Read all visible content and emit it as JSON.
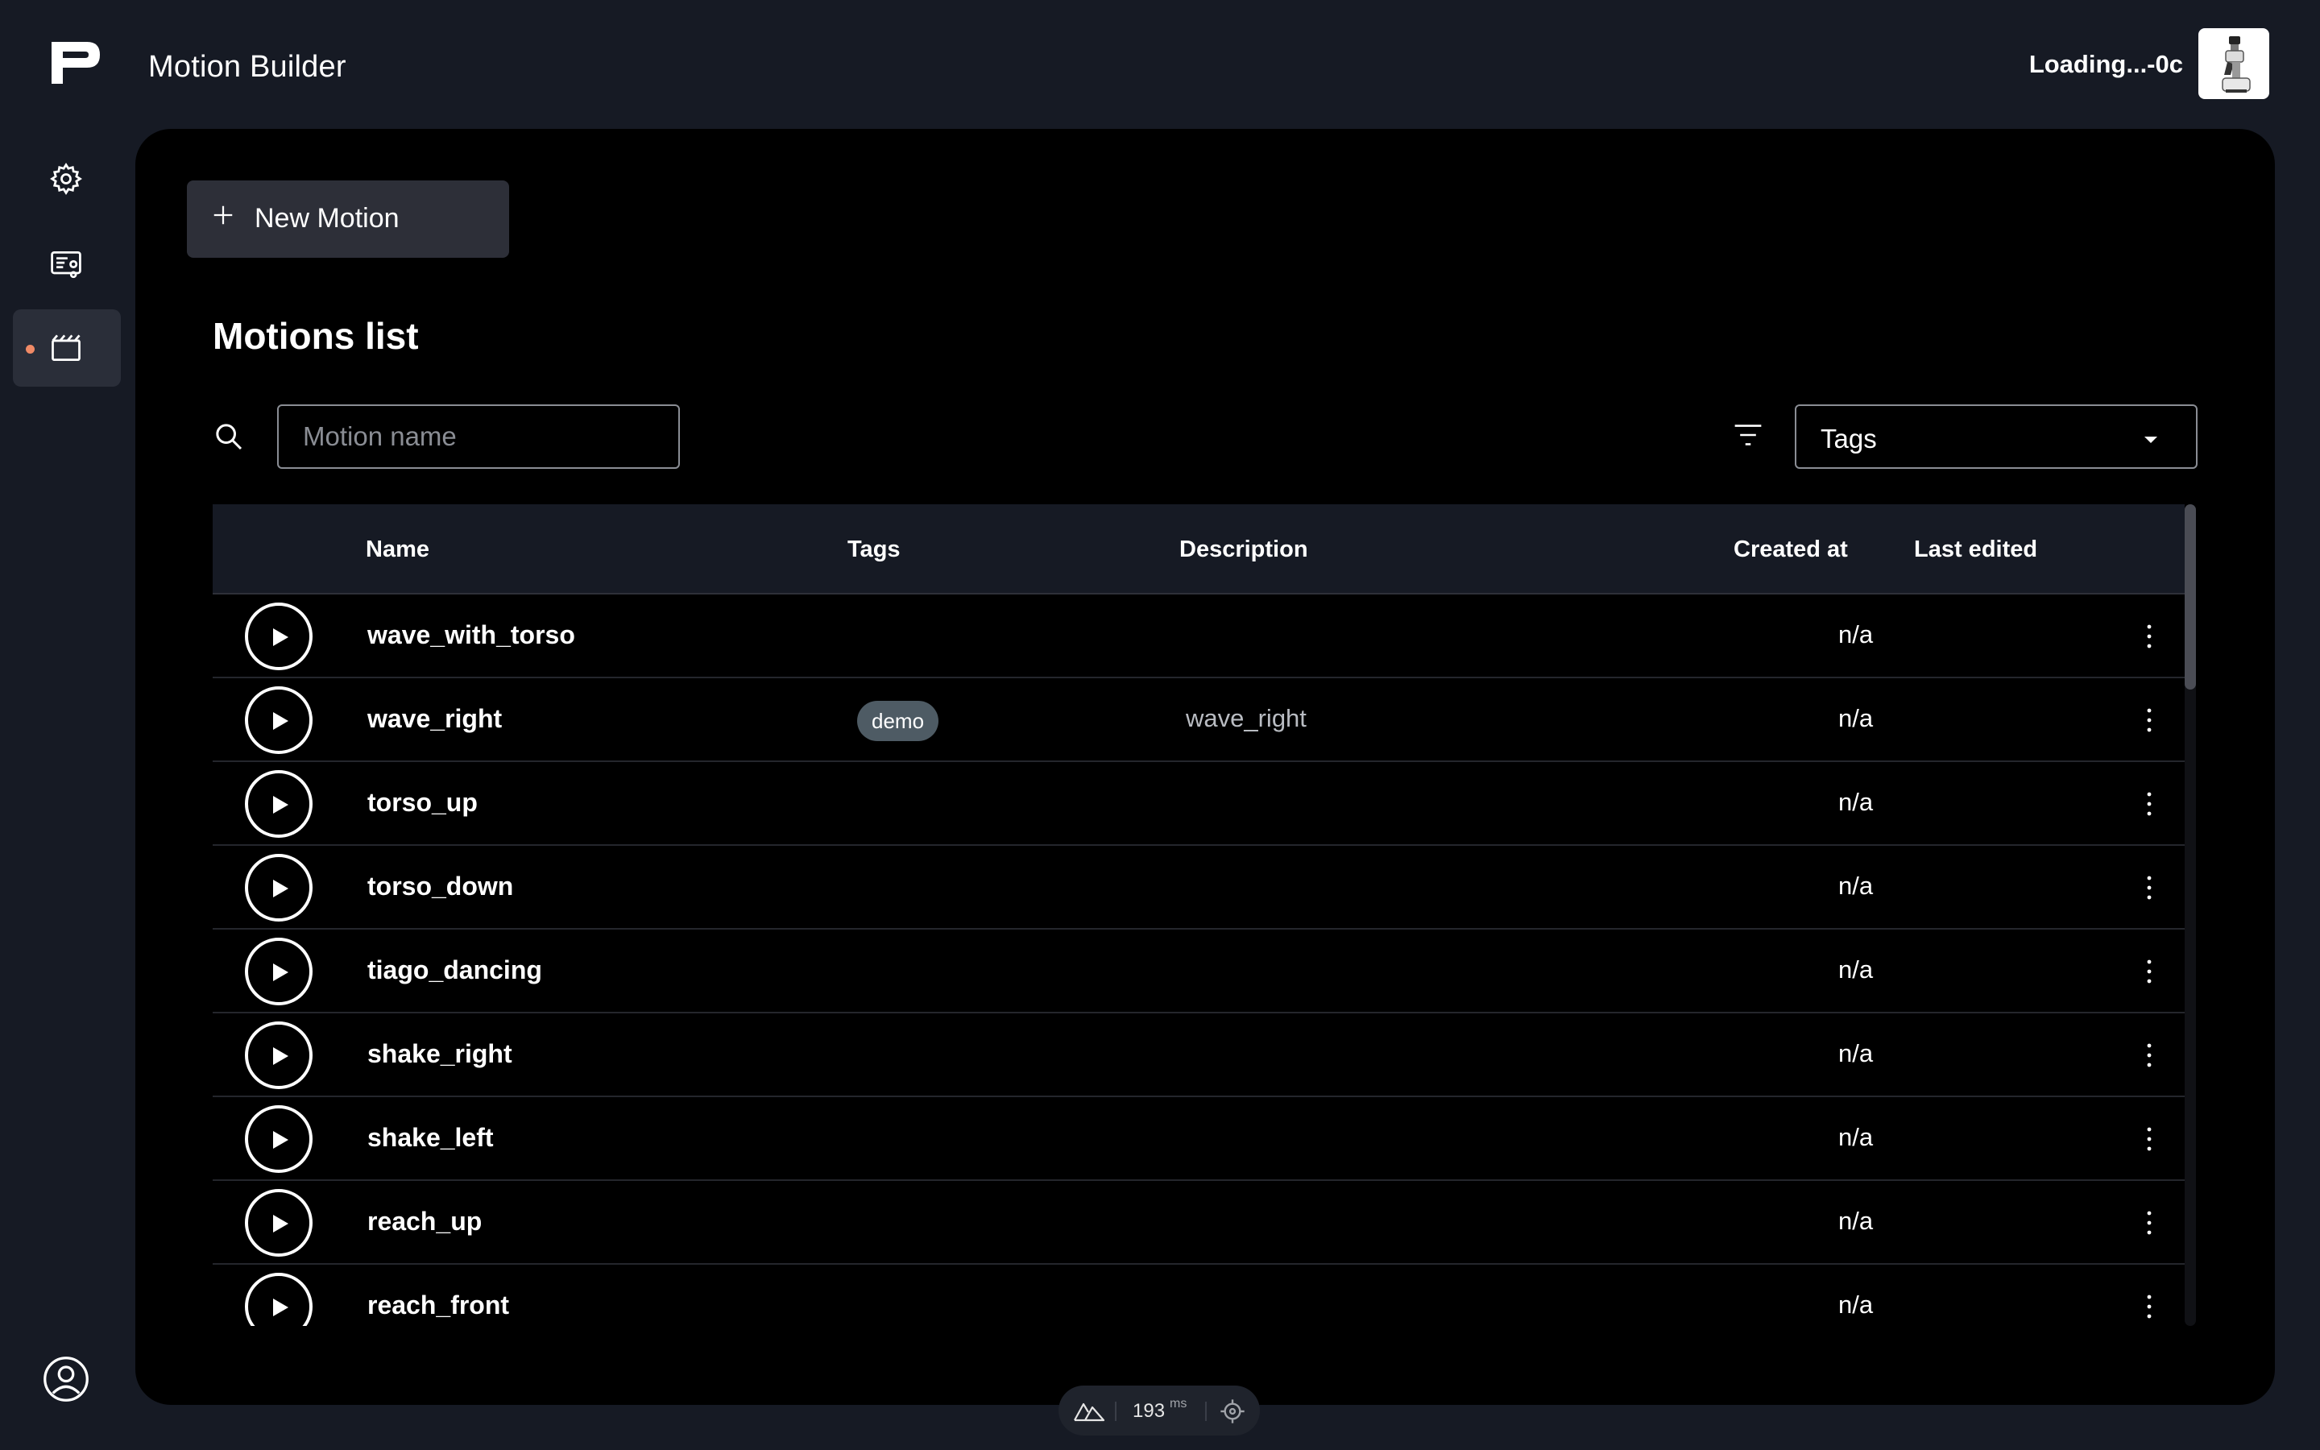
{
  "header": {
    "title": "Motion Builder",
    "status": "Loading...-0c"
  },
  "sidebar": {
    "items": [
      {
        "icon": "gear-icon",
        "active": false
      },
      {
        "icon": "settings-list-icon",
        "active": false
      },
      {
        "icon": "clapperboard-icon",
        "active": true
      }
    ]
  },
  "toolbar": {
    "new_label": "New Motion"
  },
  "list": {
    "title": "Motions list",
    "search_placeholder": "Motion name",
    "tags_select": "Tags"
  },
  "table": {
    "columns": [
      "Name",
      "Tags",
      "Description",
      "Created at",
      "Last edited"
    ],
    "rows": [
      {
        "name": "wave_with_torso",
        "tag": "",
        "description": "",
        "created": "n/a"
      },
      {
        "name": "wave_right",
        "tag": "demo",
        "description": "wave_right",
        "created": "n/a"
      },
      {
        "name": "torso_up",
        "tag": "",
        "description": "",
        "created": "n/a"
      },
      {
        "name": "torso_down",
        "tag": "",
        "description": "",
        "created": "n/a"
      },
      {
        "name": "tiago_dancing",
        "tag": "",
        "description": "",
        "created": "n/a"
      },
      {
        "name": "shake_right",
        "tag": "",
        "description": "",
        "created": "n/a"
      },
      {
        "name": "shake_left",
        "tag": "",
        "description": "",
        "created": "n/a"
      },
      {
        "name": "reach_up",
        "tag": "",
        "description": "",
        "created": "n/a"
      },
      {
        "name": "reach_front",
        "tag": "",
        "description": "",
        "created": "n/a"
      }
    ]
  },
  "perf": {
    "value": "193",
    "unit": "ms"
  },
  "colors": {
    "background": "#161a24",
    "panel": "#000000",
    "accent_dot": "#f08a66",
    "tag_badge": "#4e5b64"
  }
}
